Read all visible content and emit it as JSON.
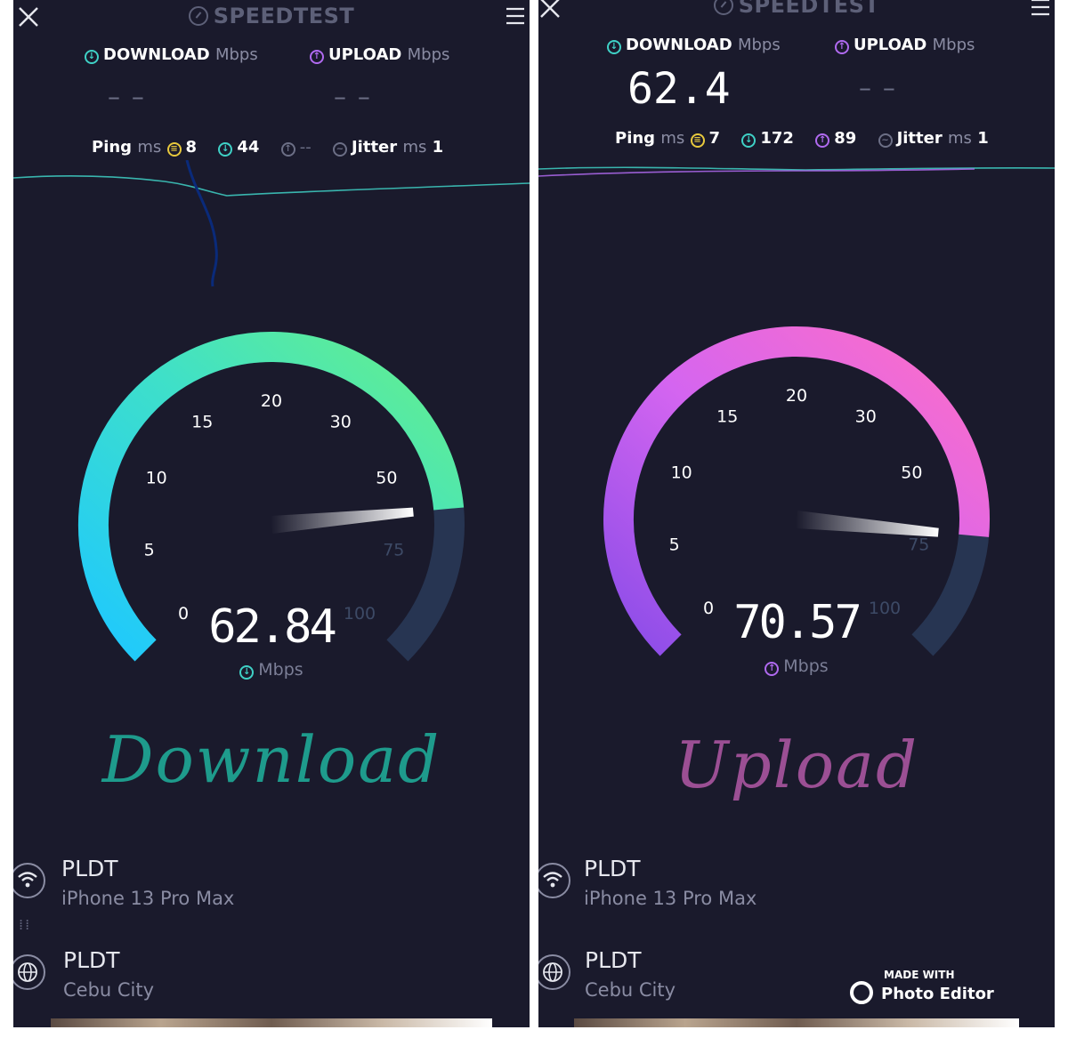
{
  "left": {
    "brand": "SPEEDTEST",
    "download_label": "DOWNLOAD",
    "upload_label": "UPLOAD",
    "unit_mbps": "Mbps",
    "download_value": "– –",
    "upload_value": "– –",
    "ping_label": "Ping",
    "ms": "ms",
    "ping_idle": "8",
    "ping_down": "44",
    "ping_up": "--",
    "jitter_label": "Jitter",
    "jitter_value": "1",
    "gauge_ticks": [
      "0",
      "5",
      "10",
      "15",
      "20",
      "30",
      "50",
      "75",
      "100"
    ],
    "gauge_value": "62.84",
    "gauge_unit": "Mbps",
    "handwriting": "Download",
    "provider1_name": "PLDT",
    "provider1_sub": "iPhone 13 Pro Max",
    "provider2_name": "PLDT",
    "provider2_sub": "Cebu City"
  },
  "right": {
    "brand": "SPEEDTEST",
    "download_label": "DOWNLOAD",
    "upload_label": "UPLOAD",
    "unit_mbps": "Mbps",
    "download_value": "62.4",
    "upload_value": "– –",
    "ping_label": "Ping",
    "ms": "ms",
    "ping_idle": "7",
    "ping_down": "172",
    "ping_up": "89",
    "jitter_label": "Jitter",
    "jitter_value": "1",
    "gauge_ticks": [
      "0",
      "5",
      "10",
      "15",
      "20",
      "30",
      "50",
      "75",
      "100"
    ],
    "gauge_value": "70.57",
    "gauge_unit": "Mbps",
    "handwriting": "Upload",
    "provider1_name": "PLDT",
    "provider1_sub": "iPhone 13 Pro Max",
    "provider2_name": "PLDT",
    "provider2_sub": "Cebu City",
    "watermark_top": "MADE WITH",
    "watermark_bottom": "Photo Editor"
  },
  "colors": {
    "background": "#1a1a2c",
    "download_accent": "#3fd1c6",
    "upload_accent": "#b06af0",
    "download_handwriting": "#1e9b8c",
    "upload_handwriting": "#9b4f94"
  }
}
